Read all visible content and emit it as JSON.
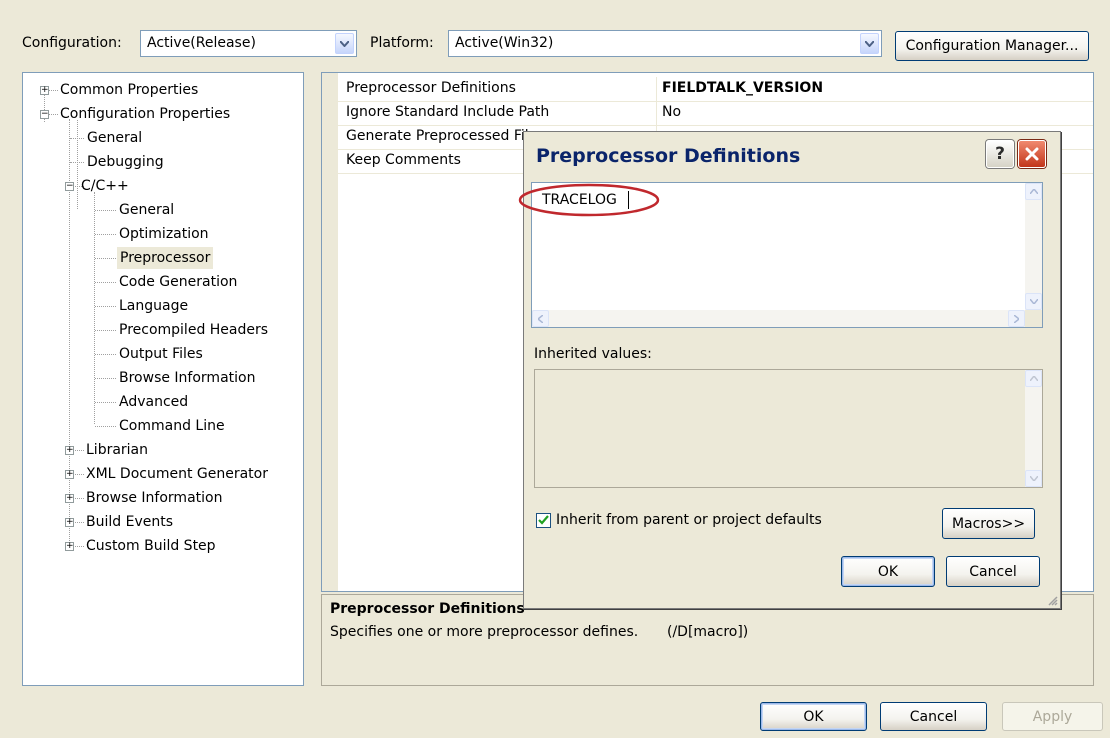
{
  "config_bar": {
    "configuration_label": "Configuration:",
    "configuration_value": "Active(Release)",
    "platform_label": "Platform:",
    "platform_value": "Active(Win32)",
    "config_manager_button": "Configuration Manager..."
  },
  "tree": {
    "items": [
      {
        "label": "Common Properties",
        "expander": "+"
      },
      {
        "label": "Configuration Properties",
        "expander": "-"
      },
      {
        "label": "General"
      },
      {
        "label": "Debugging"
      },
      {
        "label": "C/C++",
        "expander": "-"
      },
      {
        "label": "General"
      },
      {
        "label": "Optimization"
      },
      {
        "label": "Preprocessor",
        "selected": true
      },
      {
        "label": "Code Generation"
      },
      {
        "label": "Language"
      },
      {
        "label": "Precompiled Headers"
      },
      {
        "label": "Output Files"
      },
      {
        "label": "Browse Information"
      },
      {
        "label": "Advanced"
      },
      {
        "label": "Command Line"
      },
      {
        "label": "Librarian",
        "expander": "+"
      },
      {
        "label": "XML Document Generator",
        "expander": "+"
      },
      {
        "label": "Browse Information",
        "expander": "+"
      },
      {
        "label": "Build Events",
        "expander": "+"
      },
      {
        "label": "Custom Build Step",
        "expander": "+"
      }
    ]
  },
  "grid": {
    "rows": [
      {
        "name": "Preprocessor Definitions",
        "value": "FIELDTALK_VERSION"
      },
      {
        "name": "Ignore Standard Include Path",
        "value": "No"
      },
      {
        "name": "Generate Preprocessed File",
        "value": ""
      },
      {
        "name": "Keep Comments",
        "value": ""
      }
    ]
  },
  "description": {
    "title": "Preprocessor Definitions",
    "text": "Specifies one or more preprocessor defines.",
    "switch": "(/D[macro])"
  },
  "bottom_buttons": {
    "ok": "OK",
    "cancel": "Cancel",
    "apply": "Apply"
  },
  "dialog": {
    "title": "Preprocessor Definitions",
    "definitions_value": "TRACELOG",
    "inherited_label": "Inherited values:",
    "inherit_checkbox_label": "Inherit from parent or project defaults",
    "inherit_checked": true,
    "macros_button": "Macros>>",
    "ok": "OK",
    "cancel": "Cancel"
  },
  "colors": {
    "xp_title_blue": "#0a246a",
    "highlight_red": "#c0282d",
    "dialog_frame": "#ece9d8"
  }
}
